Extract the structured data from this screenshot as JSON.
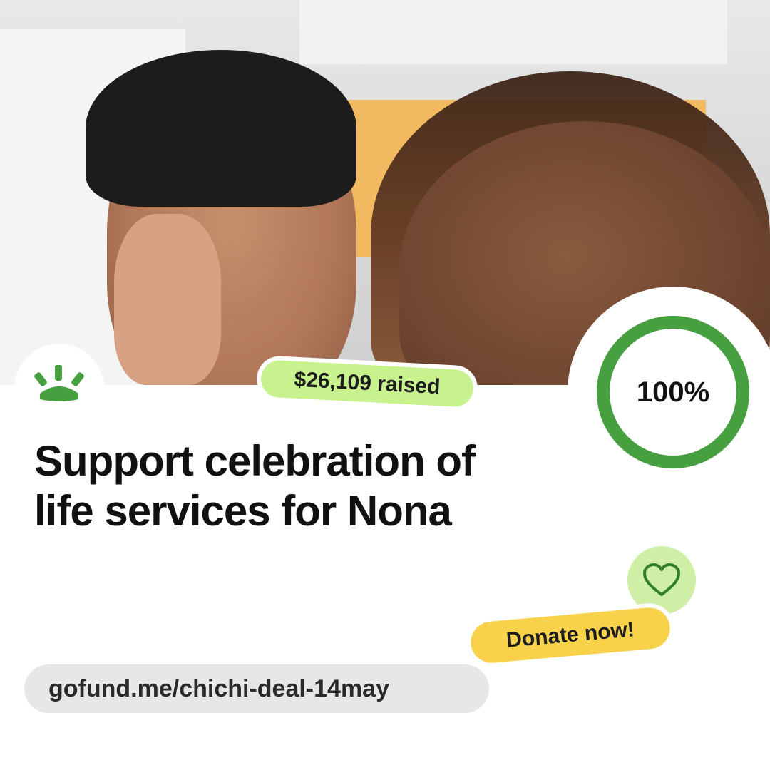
{
  "campaign": {
    "raised_text": "$26,109 raised",
    "progress_percent": 100,
    "progress_label": "100%",
    "title_line1": "Support celebration of",
    "title_line2": "life services for Nona",
    "donate_label": "Donate now!",
    "url": "gofund.me/chichi-deal-14may"
  },
  "icons": {
    "logo": "gofundme-sunrise-logo-icon",
    "heart": "heart-outline-icon"
  },
  "colors": {
    "brand_green": "#46a03f",
    "raised_pill": "#c7f28e",
    "donate_pill": "#f7d24a",
    "heart_badge": "#cfefa6",
    "url_pill": "#e7e7e7"
  }
}
